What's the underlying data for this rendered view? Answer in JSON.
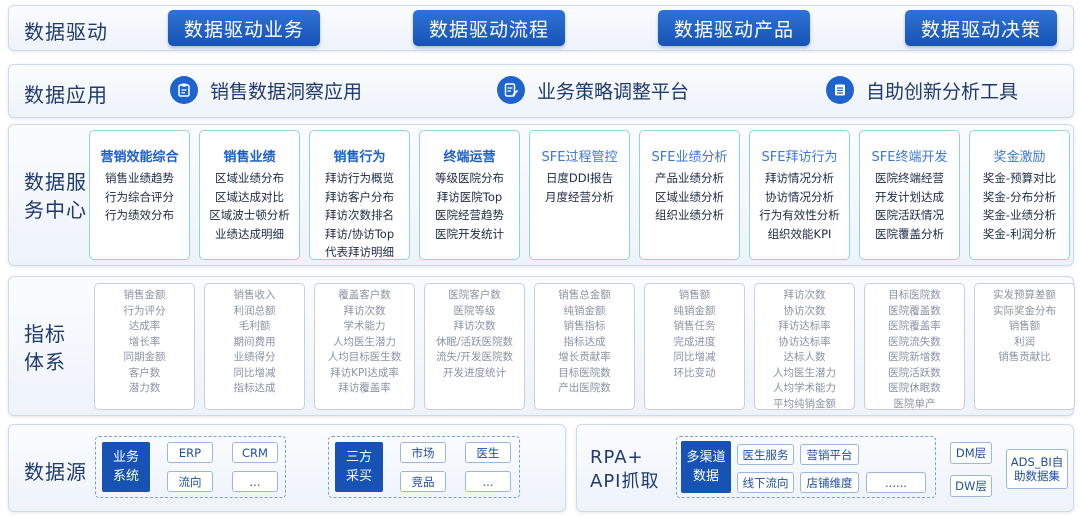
{
  "rows": {
    "drive": {
      "title": "数据驱动",
      "buttons": [
        "数据驱动业务",
        "数据驱动流程",
        "数据驱动产品",
        "数据驱动决策"
      ]
    },
    "application": {
      "title": "数据应用",
      "items": [
        {
          "label": "销售数据洞察应用",
          "icon": "clipboard-icon"
        },
        {
          "label": "业务策略调整平台",
          "icon": "edit-document-icon"
        },
        {
          "label": "自助创新分析工具",
          "icon": "list-icon"
        }
      ]
    },
    "service": {
      "title_line1": "数据服",
      "title_line2": "务中心",
      "cards": [
        {
          "title": "营销效能综合",
          "lines": [
            "销售业绩趋势",
            "行为综合评分",
            "行为绩效分布"
          ]
        },
        {
          "title": "销售业绩",
          "lines": [
            "区域业绩分布",
            "区域达成对比",
            "区域波士顿分析",
            "业绩达成明细"
          ]
        },
        {
          "title": "销售行为",
          "lines": [
            "拜访行为概览",
            "拜访客户分布",
            "拜访次数排名",
            "拜访/协访Top",
            "代表拜访明细"
          ]
        },
        {
          "title": "终端运营",
          "lines": [
            "等级医院分布",
            "拜访医院Top",
            "医院经营趋势",
            "医院开发统计"
          ]
        },
        {
          "title": "SFE过程管控",
          "lines": [
            "日度DDI报告",
            "月度经营分析"
          ]
        },
        {
          "title": "SFE业绩分析",
          "lines": [
            "产品业绩分析",
            "区域业绩分析",
            "组织业绩分析"
          ]
        },
        {
          "title": "SFE拜访行为",
          "lines": [
            "拜访情况分析",
            "协访情况分析",
            "行为有效性分析",
            "组织效能KPI"
          ]
        },
        {
          "title": "SFE终端开发",
          "lines": [
            "医院终端经营",
            "开发计划达成",
            "医院活跃情况",
            "医院覆盖分析"
          ]
        },
        {
          "title": "奖金激励",
          "lines": [
            "奖金-预算对比",
            "奖金-分布分析",
            "奖金-业绩分析",
            "奖金-利润分析"
          ]
        }
      ]
    },
    "indicator": {
      "title_line1": "指标",
      "title_line2": "体系",
      "cards": [
        [
          "销售金额",
          "行为评分",
          "达成率",
          "增长率",
          "同期金额",
          "客户数",
          "潜力数"
        ],
        [
          "销售收入",
          "利润总额",
          "毛利额",
          "期间费用",
          "业绩得分",
          "同比增减",
          "指标达成"
        ],
        [
          "覆盖客户数",
          "拜访次数",
          "学术能力",
          "人均医生潜力",
          "人均目标医生数",
          "拜访KPI达成率",
          "拜访覆盖率"
        ],
        [
          "医院客户数",
          "医院等级",
          "拜访次数",
          "休眠/活跃医院数",
          "流失/开发医院数",
          "开发进度统计"
        ],
        [
          "销售总金额",
          "纯销金额",
          "销售指标",
          "指标达成",
          "增长贡献率",
          "目标医院数",
          "产出医院数"
        ],
        [
          "销售额",
          "纯销金额",
          "销售任务",
          "完成进度",
          "同比增减",
          "环比变动"
        ],
        [
          "拜访次数",
          "协访次数",
          "拜访达标率",
          "协访达标率",
          "达标人数",
          "人均医生潜力",
          "人均学术能力",
          "平均纯销金额"
        ],
        [
          "目标医院数",
          "医院覆盖数",
          "医院覆盖率",
          "医院流失数",
          "医院新增数",
          "医院活跃数",
          "医院休眠数",
          "医院单产"
        ],
        [
          "实发预算差额",
          "实际奖金分布",
          "销售额",
          "利润",
          "销售贡献比"
        ]
      ]
    },
    "source": {
      "title": "数据源",
      "group1": {
        "main": [
          "业务",
          "系统"
        ],
        "chips": [
          "ERP",
          "CRM",
          "流向",
          "..."
        ]
      },
      "group2": {
        "main": [
          "三方",
          "采买"
        ],
        "chips": [
          "市场",
          "医生",
          "竞品",
          "..."
        ]
      },
      "rpa_line1": "RPA+",
      "rpa_line2": "API抓取",
      "group3": {
        "main": [
          "多渠道",
          "数据"
        ],
        "chips": [
          "医生服务",
          "营销平台",
          "线下流向",
          "店铺维度",
          "......"
        ]
      },
      "dm": "DM层",
      "dw": "DW层",
      "ads_line1": "ADS_BI自",
      "ads_line2": "助数据集"
    }
  }
}
